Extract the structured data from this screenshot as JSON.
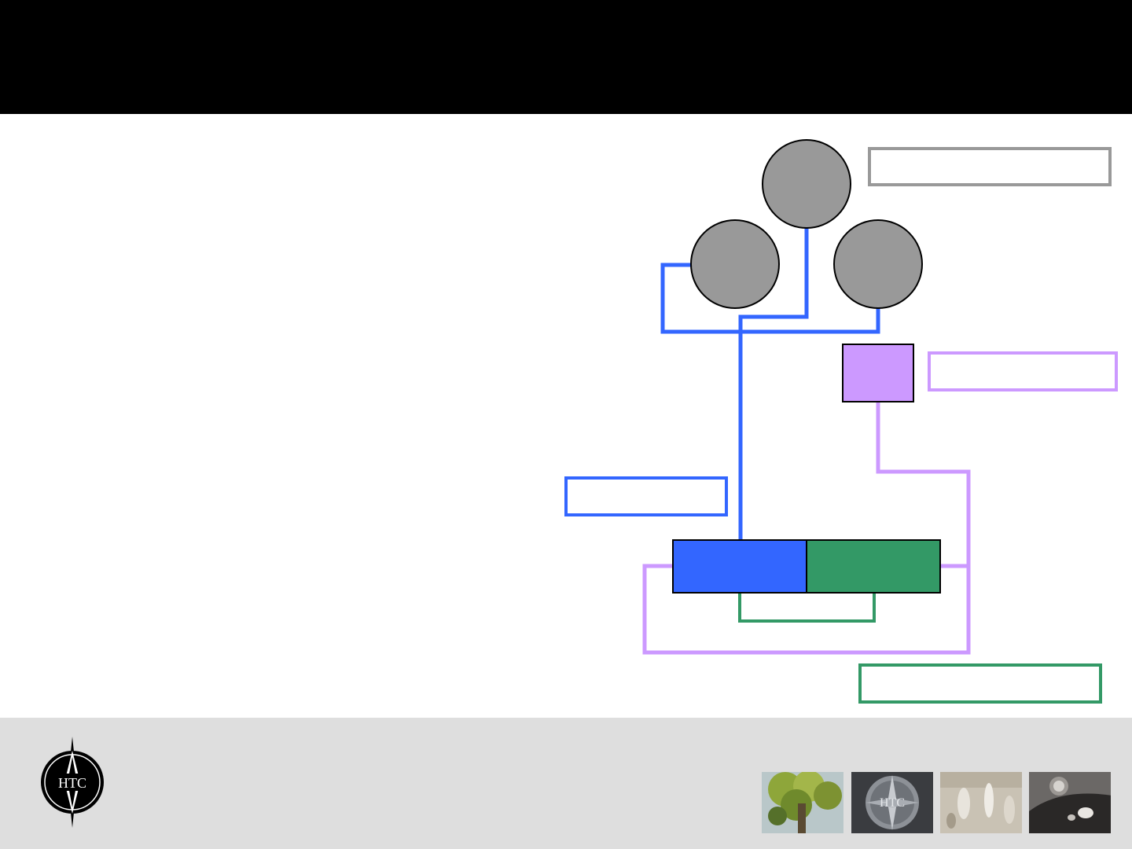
{
  "diagram": {
    "nodes": [
      {
        "id": "circle-top",
        "shape": "circle",
        "color": "#999999",
        "label": ""
      },
      {
        "id": "circle-left",
        "shape": "circle",
        "color": "#999999",
        "label": ""
      },
      {
        "id": "circle-right",
        "shape": "circle",
        "color": "#999999",
        "label": ""
      },
      {
        "id": "purple-square",
        "shape": "square",
        "color": "#cc99ff",
        "label": ""
      },
      {
        "id": "blue-block",
        "shape": "rect",
        "color": "#3366ff",
        "label": ""
      },
      {
        "id": "green-block",
        "shape": "rect",
        "color": "#339966",
        "label": ""
      }
    ],
    "callouts": [
      {
        "id": "callout-gray",
        "border_color": "#999999",
        "text": ""
      },
      {
        "id": "callout-purple",
        "border_color": "#cc99ff",
        "text": ""
      },
      {
        "id": "callout-blue",
        "border_color": "#3366ff",
        "text": ""
      },
      {
        "id": "callout-green",
        "border_color": "#339966",
        "text": ""
      }
    ],
    "connector_colors": {
      "blue": "#3366ff",
      "purple": "#cc99ff",
      "green": "#339966"
    }
  },
  "footer": {
    "logo_text": "HTC",
    "thumbnails": [
      {
        "icon": "tree-photo"
      },
      {
        "icon": "htc-emblem-photo"
      },
      {
        "icon": "floor-texture-photo"
      },
      {
        "icon": "vehicle-headlight-photo"
      }
    ]
  }
}
